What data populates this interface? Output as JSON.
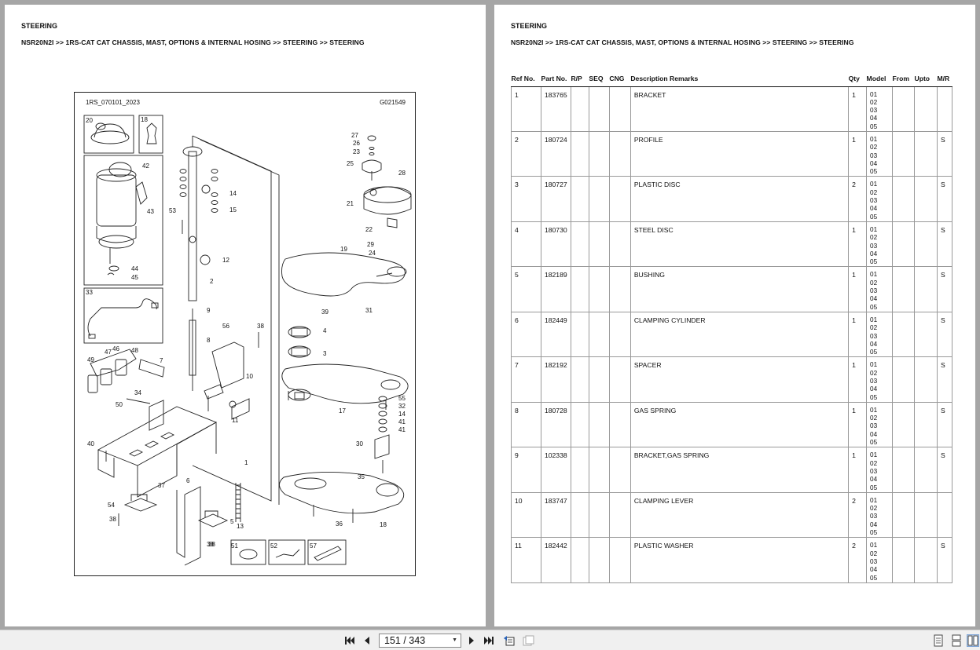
{
  "left_page": {
    "title": "STEERING",
    "breadcrumb": "NSR20N2I >> 1RS-CAT CAT CHASSIS, MAST, OPTIONS & INTERNAL HOSING >> STEERING >> STEERING",
    "diagram": {
      "code_left": "1RS_070101_2023",
      "code_right": "G021549",
      "callouts": [
        "20",
        "18",
        "42",
        "43",
        "44",
        "45",
        "33",
        "47",
        "46",
        "48",
        "49",
        "50",
        "34",
        "7",
        "40",
        "54",
        "38",
        "37",
        "6",
        "38",
        "27",
        "26",
        "23",
        "25",
        "28",
        "14",
        "15",
        "21",
        "53",
        "22",
        "12",
        "19",
        "29",
        "24",
        "2",
        "39",
        "31",
        "9",
        "56",
        "38",
        "4",
        "3",
        "8",
        "10",
        "11",
        "55",
        "32",
        "14",
        "41",
        "41",
        "17",
        "30",
        "1",
        "35",
        "13",
        "36",
        "18",
        "5",
        "38",
        "51",
        "52",
        "57"
      ]
    }
  },
  "right_page": {
    "title": "STEERING",
    "breadcrumb": "NSR20N2I >> 1RS-CAT CAT CHASSIS, MAST, OPTIONS & INTERNAL HOSING >> STEERING >> STEERING",
    "table": {
      "headers": [
        "Ref No.",
        "Part No.",
        "R/P",
        "SEQ",
        "CNG",
        "Description Remarks",
        "Qty",
        "Model",
        "From",
        "Upto",
        "M/R"
      ],
      "rows": [
        {
          "ref": "1",
          "part": "183765",
          "rp": "",
          "seq": "",
          "cng": "",
          "desc": "BRACKET",
          "qty": "1",
          "models": [
            "01",
            "02",
            "03",
            "04",
            "05"
          ],
          "from": "",
          "upto": "",
          "mr": ""
        },
        {
          "ref": "2",
          "part": "180724",
          "rp": "",
          "seq": "",
          "cng": "",
          "desc": "PROFILE",
          "qty": "1",
          "models": [
            "01",
            "02",
            "03",
            "04",
            "05"
          ],
          "from": "",
          "upto": "",
          "mr": "S"
        },
        {
          "ref": "3",
          "part": "180727",
          "rp": "",
          "seq": "",
          "cng": "",
          "desc": "PLASTIC DISC",
          "qty": "2",
          "models": [
            "01",
            "02",
            "03",
            "04",
            "05"
          ],
          "from": "",
          "upto": "",
          "mr": "S"
        },
        {
          "ref": "4",
          "part": "180730",
          "rp": "",
          "seq": "",
          "cng": "",
          "desc": "STEEL DISC",
          "qty": "1",
          "models": [
            "01",
            "02",
            "03",
            "04",
            "05"
          ],
          "from": "",
          "upto": "",
          "mr": "S"
        },
        {
          "ref": "5",
          "part": "182189",
          "rp": "",
          "seq": "",
          "cng": "",
          "desc": "BUSHING",
          "qty": "1",
          "models": [
            "01",
            "02",
            "03",
            "04",
            "05"
          ],
          "from": "",
          "upto": "",
          "mr": "S"
        },
        {
          "ref": "6",
          "part": "182449",
          "rp": "",
          "seq": "",
          "cng": "",
          "desc": "CLAMPING CYLINDER",
          "qty": "1",
          "models": [
            "01",
            "02",
            "03",
            "04",
            "05"
          ],
          "from": "",
          "upto": "",
          "mr": "S"
        },
        {
          "ref": "7",
          "part": "182192",
          "rp": "",
          "seq": "",
          "cng": "",
          "desc": "SPACER",
          "qty": "1",
          "models": [
            "01",
            "02",
            "03",
            "04",
            "05"
          ],
          "from": "",
          "upto": "",
          "mr": "S"
        },
        {
          "ref": "8",
          "part": "180728",
          "rp": "",
          "seq": "",
          "cng": "",
          "desc": "GAS SPRING",
          "qty": "1",
          "models": [
            "01",
            "02",
            "03",
            "04",
            "05"
          ],
          "from": "",
          "upto": "",
          "mr": "S"
        },
        {
          "ref": "9",
          "part": "102338",
          "rp": "",
          "seq": "",
          "cng": "",
          "desc": "BRACKET,GAS SPRING",
          "qty": "1",
          "models": [
            "01",
            "02",
            "03",
            "04",
            "05"
          ],
          "from": "",
          "upto": "",
          "mr": "S"
        },
        {
          "ref": "10",
          "part": "183747",
          "rp": "",
          "seq": "",
          "cng": "",
          "desc": "CLAMPING LEVER",
          "qty": "2",
          "models": [
            "01",
            "02",
            "03",
            "04",
            "05"
          ],
          "from": "",
          "upto": "",
          "mr": ""
        },
        {
          "ref": "11",
          "part": "182442",
          "rp": "",
          "seq": "",
          "cng": "",
          "desc": "PLASTIC WASHER",
          "qty": "2",
          "models": [
            "01",
            "02",
            "03",
            "04",
            "05"
          ],
          "from": "",
          "upto": "",
          "mr": "S"
        }
      ]
    }
  },
  "toolbar": {
    "page_indicator": "151 / 343",
    "icons": [
      "first-page-icon",
      "prev-page-icon",
      "next-page-icon",
      "last-page-icon",
      "prev-view-icon",
      "next-view-icon",
      "single-page-icon",
      "continuous-icon",
      "facing-pages-icon"
    ]
  }
}
